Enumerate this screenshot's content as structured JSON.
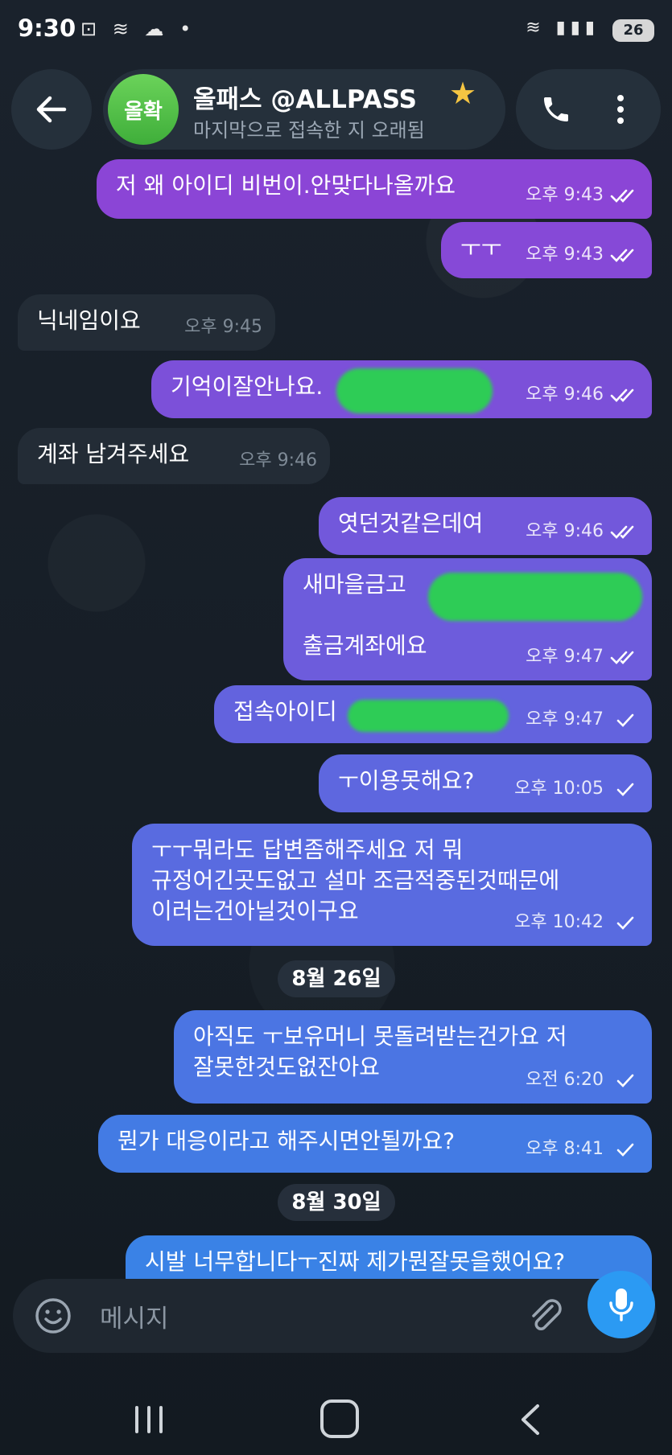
{
  "status_bar": {
    "time": "9:30",
    "left_icons": "⊡ ≋ ☁ •",
    "right_icons": "≋ ▮▮▮",
    "battery": "26"
  },
  "header": {
    "avatar_text": "올확",
    "chat_name": "올패스 @ALLPASS",
    "star": "★",
    "status": "마지막으로 접속한 지 오래됨"
  },
  "colors": {
    "bubble_top": "#8b45d6",
    "bubble_bottom": "#3a82e6",
    "accent": "#2b9af3",
    "redaction": "#2ecc56"
  },
  "messages": [
    {
      "dir": "out",
      "text": "저 왜 아이디 비번이.안맞다나올까요",
      "time": "오후 9:43",
      "status": "read"
    },
    {
      "dir": "out",
      "text": "ㅜㅜ",
      "time": "오후 9:43",
      "status": "read"
    },
    {
      "dir": "in",
      "text": "닉네임이요",
      "time": "오후 9:45"
    },
    {
      "dir": "out",
      "text": "기억이잘안나요.                  ??",
      "time": "오후 9:46",
      "status": "read"
    },
    {
      "dir": "in",
      "text": "계좌 남겨주세요",
      "time": "오후 9:46"
    },
    {
      "dir": "out",
      "text": "엿던것같은데여",
      "time": "오후 9:46",
      "status": "read"
    },
    {
      "dir": "out",
      "text": "새마을금고\n\n출금계좌에요",
      "time": "오후 9:47",
      "status": "read"
    },
    {
      "dir": "out",
      "text": "접속아이디",
      "time": "오후 9:47",
      "status": "sent"
    },
    {
      "dir": "out",
      "text": "ㅜ이용못해요?",
      "time": "오후 10:05",
      "status": "sent"
    },
    {
      "dir": "out",
      "text": "ㅜㅜ뭐라도 답변좀해주세요 저 뭐\n규정어긴곳도없고 설마 조금적중된것때문에\n이러는건아닐것이구요",
      "time": "오후 10:42",
      "status": "sent"
    },
    {
      "dir": "out",
      "text": "아직도 ㅜ보유머니 못돌려받는건가요 저\n잘못한것도없잔아요",
      "time": "오전 6:20",
      "status": "sent"
    },
    {
      "dir": "out",
      "text": "뭔가 대응이라고 해주시면안될까요?",
      "time": "오후 8:41",
      "status": "sent"
    },
    {
      "dir": "out",
      "text": "시발 너무합니다ㅜ진짜 제가뭔잘못을했어요?",
      "time": "",
      "status": ""
    }
  ],
  "dates": [
    "8월 26일",
    "8월 30일"
  ],
  "input": {
    "placeholder": "메시지"
  }
}
